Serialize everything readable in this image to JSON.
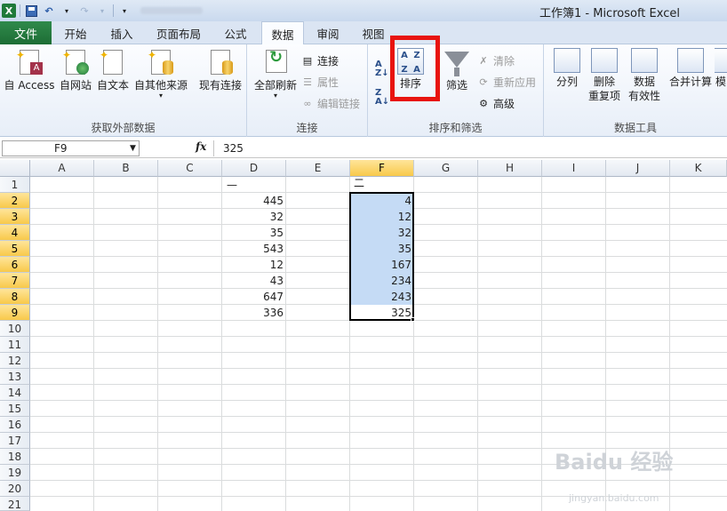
{
  "window": {
    "title": "工作簿1 - Microsoft Excel"
  },
  "tabs": [
    "文件",
    "开始",
    "插入",
    "页面布局",
    "公式",
    "数据",
    "审阅",
    "视图"
  ],
  "active_tab": "数据",
  "ribbon": {
    "get_external": {
      "label": "获取外部数据",
      "from_access": "自 Access",
      "from_web": "自网站",
      "from_text": "自文本",
      "from_other": "自其他来源",
      "existing": "现有连接"
    },
    "connections": {
      "label": "连接",
      "refresh_all": "全部刷新",
      "connections": "连接",
      "properties": "属性",
      "edit_links": "编辑链接"
    },
    "sort_filter": {
      "label": "排序和筛选",
      "sort": "排序",
      "filter": "筛选",
      "clear": "清除",
      "reapply": "重新应用",
      "advanced": "高级"
    },
    "data_tools": {
      "label": "数据工具",
      "text_to_columns": "分列",
      "remove_duplicates_1": "删除",
      "remove_duplicates_2": "重复项",
      "validation_1": "数据",
      "validation_2": "有效性",
      "consolidate": "合并计算",
      "what_if": "模"
    }
  },
  "formula_bar": {
    "name_box": "F9",
    "fx": "fx",
    "value": "325"
  },
  "columns": [
    "A",
    "B",
    "C",
    "D",
    "E",
    "F",
    "G",
    "H",
    "I",
    "J",
    "K"
  ],
  "rows": [
    "1",
    "2",
    "3",
    "4",
    "5",
    "6",
    "7",
    "8",
    "9",
    "10",
    "11",
    "12",
    "13",
    "14",
    "15",
    "16",
    "17",
    "18",
    "19",
    "20",
    "21"
  ],
  "header_marks": {
    "d1": "—",
    "f1": "二"
  },
  "column_d": [
    "445",
    "32",
    "35",
    "543",
    "12",
    "43",
    "647",
    "336"
  ],
  "column_f": [
    "4",
    "12",
    "32",
    "35",
    "167",
    "234",
    "243",
    "325"
  ],
  "watermark": {
    "main": "Baidu 经验",
    "sub": "jingyan.baidu.com"
  },
  "colors": {
    "file_tab": "#1d6d35",
    "selection": "#c5dbf5",
    "highlight": "#e8140f",
    "selected_header": "#f8c94b"
  }
}
